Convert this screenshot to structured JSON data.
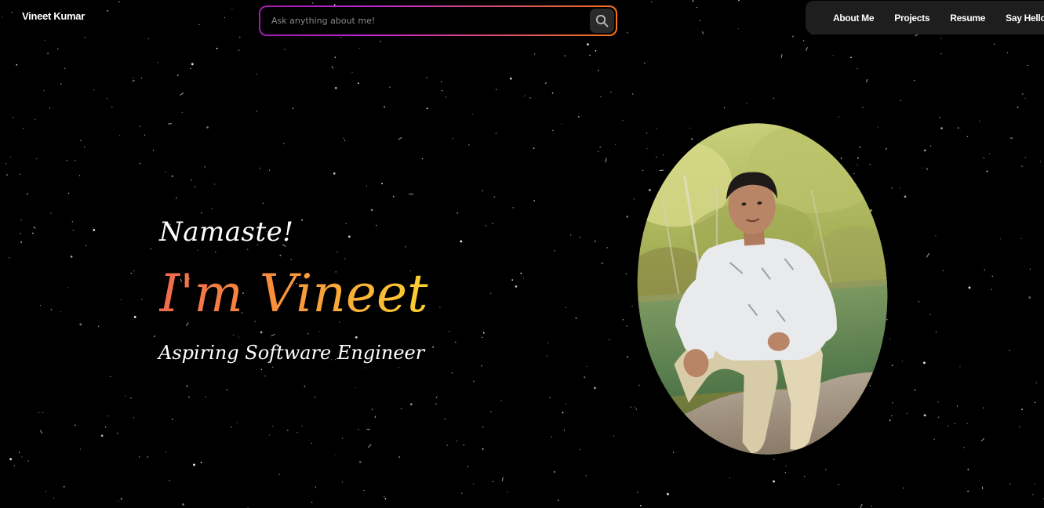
{
  "header": {
    "brand": "Vineet Kumar",
    "search": {
      "placeholder": "Ask anything about me!",
      "value": ""
    },
    "nav": [
      {
        "label": "About Me"
      },
      {
        "label": "Projects"
      },
      {
        "label": "Resume"
      },
      {
        "label": "Say Hello!"
      }
    ]
  },
  "hero": {
    "greeting": "Namaste!",
    "name": "I'm Vineet",
    "subtitle": "Aspiring Software Engineer"
  },
  "icons": {
    "search": "search-icon"
  },
  "colors": {
    "background": "#000000",
    "nav_background": "#1e1e1e",
    "search_border_start": "#a21caf",
    "search_border_end": "#f97316",
    "name_gradient_start": "#f26a4d",
    "name_gradient_end": "#fbd033"
  }
}
